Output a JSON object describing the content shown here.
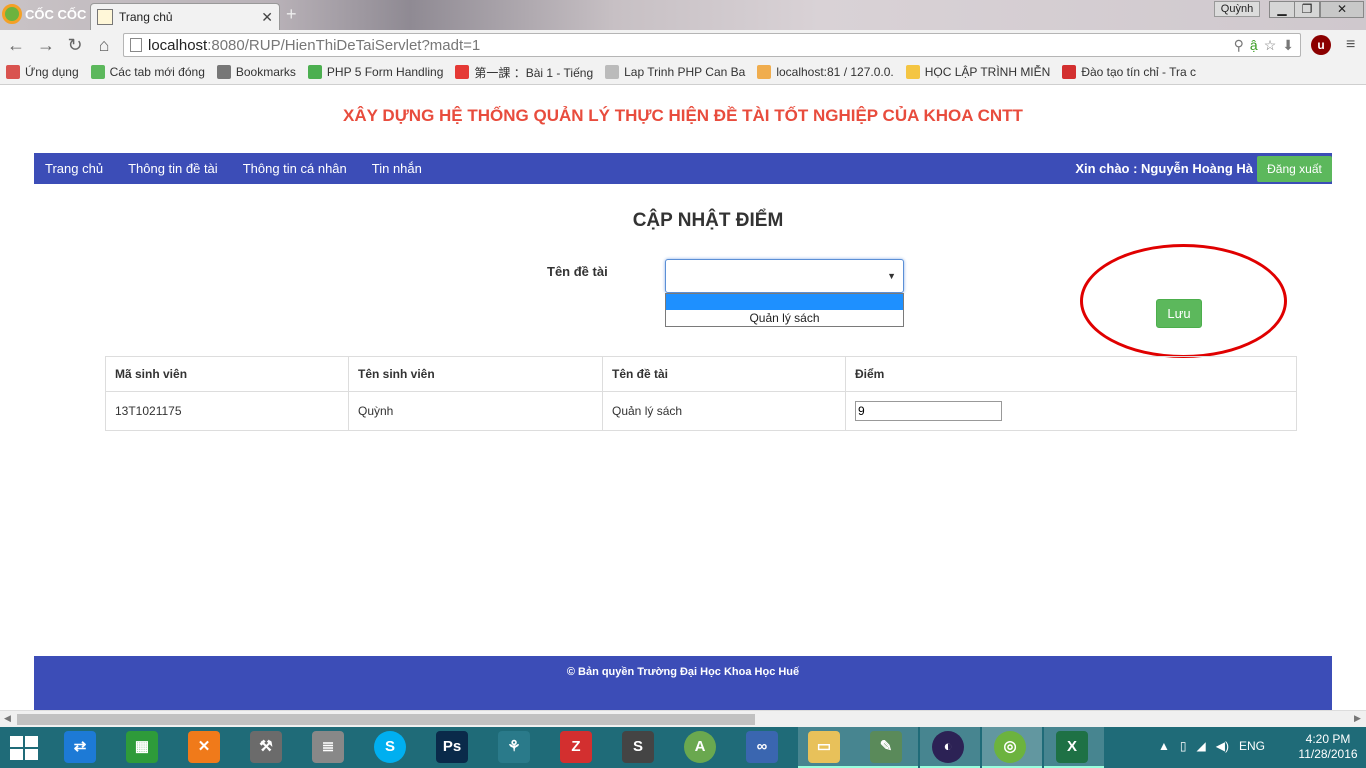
{
  "browser": {
    "brand": "CỐC CỐC",
    "tab_title": "Trang chủ",
    "tab_close": "✕",
    "new_tab": "+",
    "win_user": "Quỳnh",
    "url_host": "localhost",
    "url_rest": ":8080/RUP/HienThiDeTaiServlet?madt=1",
    "extension_label": "u",
    "bookmarks": [
      {
        "label": "Ứng dụng",
        "color": "#d9534f"
      },
      {
        "label": "Các tab mới đóng",
        "color": "#5cb85c"
      },
      {
        "label": "Bookmarks",
        "color": "#777777"
      },
      {
        "label": "PHP 5 Form Handling",
        "color": "#4caf50"
      },
      {
        "label": "第一課 ：Bài 1 - Tiếng",
        "color": "#e53935"
      },
      {
        "label": "Lap Trinh PHP Can Ba",
        "color": "#bbbbbb"
      },
      {
        "label": "localhost:81 / 127.0.0.",
        "color": "#f0ad4e"
      },
      {
        "label": "HỌC LẬP TRÌNH MIỄN",
        "color": "#f4c542"
      },
      {
        "label": "Đào tạo tín chỉ - Tra c",
        "color": "#d32f2f"
      }
    ]
  },
  "site": {
    "title": "XÂY DỰNG HỆ THỐNG QUẢN LÝ THỰC HIỆN ĐỀ TÀI TỐT NGHIỆP CỦA KHOA CNTT",
    "nav": [
      "Trang chủ",
      "Thông tin đề tài",
      "Thông tin cá nhân",
      "Tin nhắn"
    ],
    "greeting": "Xin chào : Nguyễn Hoàng Hà",
    "logout": "Đăng xuất",
    "accent": "#3c4db7",
    "title_color": "#e84c3d"
  },
  "form": {
    "heading": "CẬP NHẬT ĐIỂM",
    "topic_label": "Tên đề tài",
    "selected_value": "",
    "options": [
      "",
      "Quản lý sách"
    ],
    "save": "Lưu"
  },
  "table": {
    "headers": [
      "Mã sinh viên",
      "Tên sinh viên",
      "Tên đề tài",
      "Điểm"
    ],
    "rows": [
      {
        "student_id": "13T1021175",
        "student_name": "Quỳnh",
        "topic": "Quản lý sách",
        "score": "9"
      }
    ]
  },
  "footer": {
    "text": "© Bản quyền Trường Đại Học Khoa Học Huế"
  },
  "taskbar": {
    "language": "ENG",
    "time": "4:20 PM",
    "date": "11/28/2016"
  }
}
